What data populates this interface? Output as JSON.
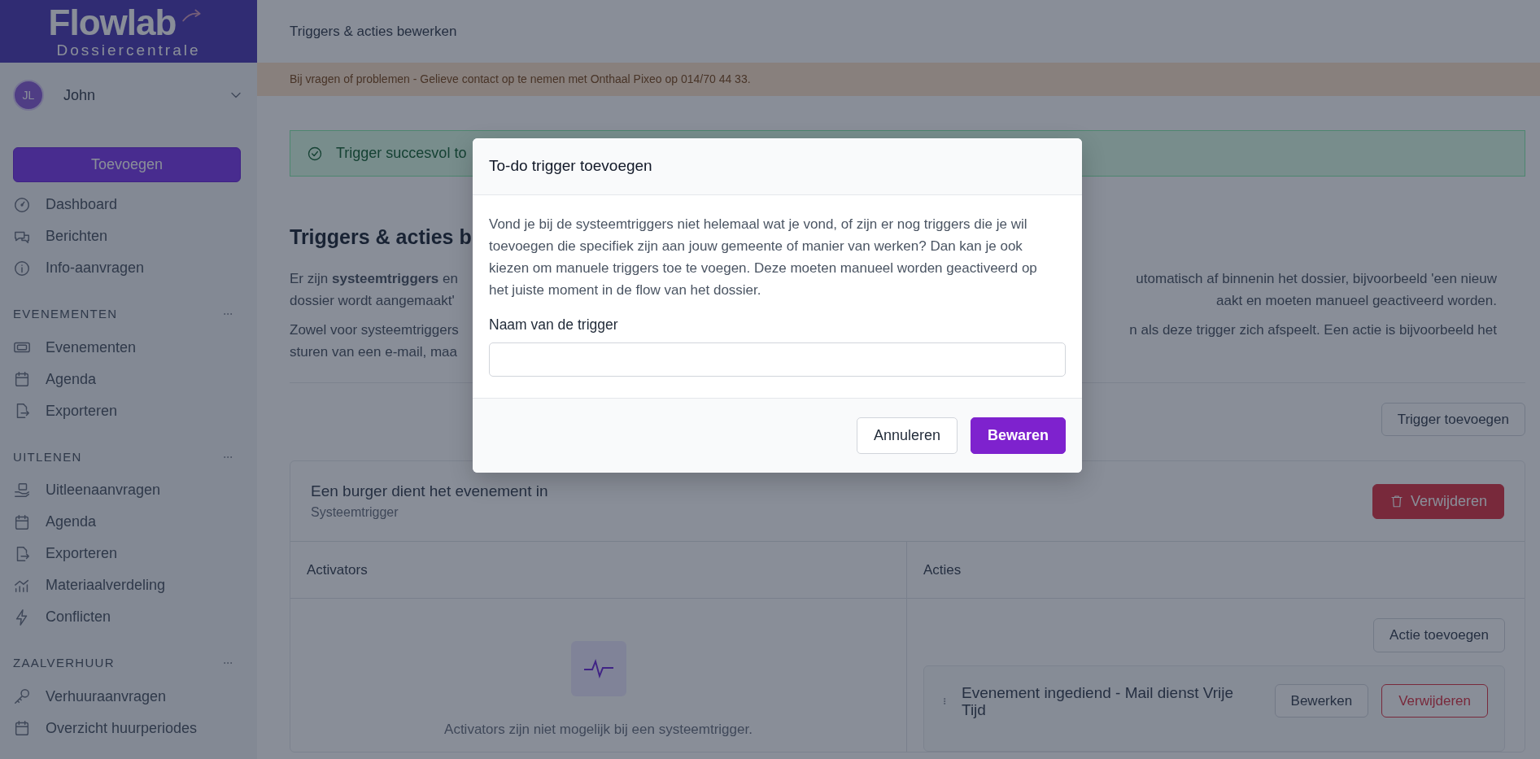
{
  "sidebar": {
    "logo": {
      "title": "Flowlab",
      "subtitle": "Dossiercentrale"
    },
    "user": {
      "initials": "JL",
      "name": "John"
    },
    "add_button": "Toevoegen",
    "items": [
      {
        "label": "Dashboard"
      },
      {
        "label": "Berichten"
      },
      {
        "label": "Info-aanvragen"
      }
    ],
    "sections": [
      {
        "title": "EVENEMENTEN",
        "items": [
          {
            "label": "Evenementen"
          },
          {
            "label": "Agenda"
          },
          {
            "label": "Exporteren"
          }
        ]
      },
      {
        "title": "UITLENEN",
        "items": [
          {
            "label": "Uitleenaanvragen"
          },
          {
            "label": "Agenda"
          },
          {
            "label": "Exporteren"
          },
          {
            "label": "Materiaalverdeling"
          },
          {
            "label": "Conflicten"
          }
        ]
      },
      {
        "title": "ZAALVERHUUR",
        "items": [
          {
            "label": "Verhuuraanvragen"
          },
          {
            "label": "Overzicht huurperiodes"
          }
        ]
      }
    ]
  },
  "topbar": {
    "title": "Triggers & acties bewerken"
  },
  "notice": "Bij vragen of problemen - Gelieve contact op te nemen met Onthaal Pixeo op 014/70 44 33.",
  "alert": "Trigger succesvol to",
  "heading": "Triggers & acties b",
  "paragraphs": [
    {
      "lines": [
        {
          "left": "Er zijn **systeemtriggers** en",
          "right": "utomatisch af binnenin het dossier, bijvoorbeeld 'een nieuw"
        },
        {
          "left": "dossier wordt aangemaakt'",
          "right": "aakt en moeten manueel geactiveerd worden."
        }
      ]
    },
    {
      "lines": [
        {
          "left": "Zowel voor systeemtriggers",
          "right": "n als deze trigger zich afspeelt. Een actie is bijvoorbeeld het"
        },
        {
          "left": "sturen van een e-mail, maa"
        }
      ]
    }
  ],
  "trigger_button": "Trigger toevoegen",
  "trigger_card": {
    "title": "Een burger dient het evenement in",
    "subtitle": "Systeemtrigger",
    "delete_button": "Verwijderen",
    "activators": {
      "heading": "Activators",
      "empty_text": "Activators zijn niet mogelijk bij een systeemtrigger."
    },
    "actions": {
      "heading": "Acties",
      "add_button": "Actie toevoegen",
      "items": [
        {
          "title": "Evenement ingediend - Mail dienst Vrije Tijd",
          "edit_button": "Bewerken",
          "delete_button": "Verwijderen"
        }
      ]
    }
  },
  "modal": {
    "title": "To-do trigger toevoegen",
    "description": "Vond je bij de systeemtriggers niet helemaal wat je vond, of zijn er nog triggers die je wil toevoegen die specifiek zijn aan jouw gemeente of manier van werken? Dan kan je ook kiezen om manuele triggers toe te voegen. Deze moeten manueel worden geactiveerd op het juiste moment in de flow van het dossier.",
    "field_label": "Naam van de trigger",
    "buttons": [
      {
        "label": "Annuleren",
        "kind": "secondary"
      },
      {
        "label": "Bewaren",
        "kind": "primary"
      }
    ]
  }
}
